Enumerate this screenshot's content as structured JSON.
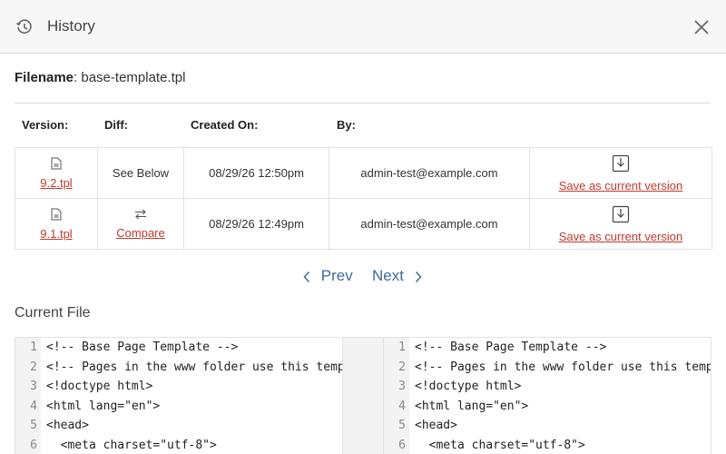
{
  "header": {
    "title": "History",
    "history_icon": "clock-history-icon",
    "close_icon": "close-icon"
  },
  "filename": {
    "label": "Filename",
    "separator": ":",
    "value": "base-template.tpl"
  },
  "columns": {
    "version": "Version:",
    "diff": "Diff:",
    "created_on": "Created On:",
    "by": "By:"
  },
  "versions": [
    {
      "version": "9.2.tpl",
      "diff": "See Below",
      "diff_is_link": false,
      "created_on": "08/29/26 12:50pm",
      "by": "admin-test@example.com",
      "action": "Save as current version"
    },
    {
      "version": "9.1.tpl",
      "diff": "Compare",
      "diff_is_link": true,
      "created_on": "08/29/26 12:49pm",
      "by": "admin-test@example.com",
      "action": "Save as current version"
    }
  ],
  "pager": {
    "prev": "Prev",
    "next": "Next"
  },
  "current_file": {
    "title": "Current File",
    "left_lines": [
      {
        "n": "1",
        "text": "<!-- Base Page Template -->"
      },
      {
        "n": "2",
        "text": "<!-- Pages in the www folder use this template"
      },
      {
        "n": "3",
        "text": "<!doctype html>"
      },
      {
        "n": "4",
        "text": "<html lang=\"en\">"
      },
      {
        "n": "5",
        "text": "<head>"
      },
      {
        "n": "6",
        "text": "  <meta charset=\"utf-8\">"
      }
    ],
    "right_lines": [
      {
        "n": "1",
        "text": "<!-- Base Page Template -->"
      },
      {
        "n": "2",
        "text": "<!-- Pages in the www folder use this template"
      },
      {
        "n": "3",
        "text": "<!doctype html>"
      },
      {
        "n": "4",
        "text": "<html lang=\"en\">"
      },
      {
        "n": "5",
        "text": "<head>"
      },
      {
        "n": "6",
        "text": "  <meta charset=\"utf-8\">"
      }
    ]
  },
  "colors": {
    "link": "#c0392b",
    "pager": "#3d6b9a",
    "border": "#dde3ea"
  }
}
